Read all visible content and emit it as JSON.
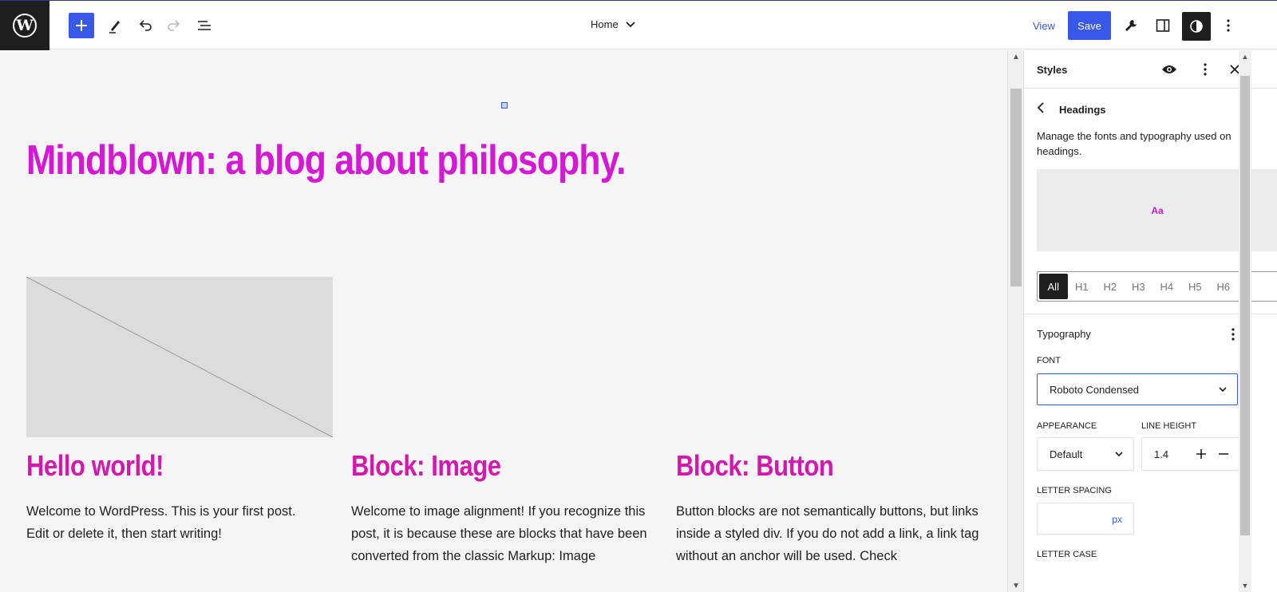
{
  "toolbar": {
    "page_title": "Home",
    "view_label": "View",
    "save_label": "Save",
    "accent_color": "#3858e9"
  },
  "canvas": {
    "site_title": "Mindblown: a blog about philosophy.",
    "heading_color": "#d418d4",
    "posts": [
      {
        "title": "Hello world!",
        "excerpt": "Welcome to WordPress. This is your first post. Edit or delete it, then start writing!"
      },
      {
        "title": "Block: Image",
        "excerpt": "Welcome to image alignment! If you recognize this post, it is because these are blocks that have been converted from the classic Markup: Image"
      },
      {
        "title": "Block: Button",
        "excerpt": "Button blocks are not semantically buttons, but links inside a styled div.  If you do not add a link, a link tag without an anchor will be used. Check"
      }
    ]
  },
  "sidebar": {
    "title": "Styles",
    "section_title": "Headings",
    "description": "Manage the fonts and typography used on headings.",
    "preview_text": "Aa",
    "levels": [
      "All",
      "H1",
      "H2",
      "H3",
      "H4",
      "H5",
      "H6"
    ],
    "active_level": "All",
    "typography_title": "Typography",
    "font_label": "FONT",
    "font_value": "Roboto Condensed",
    "appearance_label": "APPEARANCE",
    "appearance_value": "Default",
    "line_height_label": "LINE HEIGHT",
    "line_height_value": "1.4",
    "letter_spacing_label": "LETTER SPACING",
    "letter_spacing_unit": "px",
    "letter_case_label": "LETTER CASE"
  },
  "icons": [
    "wordpress-icon",
    "plus-icon",
    "pen-icon",
    "undo-icon",
    "redo-icon",
    "list-view-icon",
    "chevron-down-icon",
    "wrench-icon",
    "sidebar-icon",
    "contrast-icon",
    "kebab-menu-icon",
    "eye-icon",
    "close-icon",
    "chevron-left-icon",
    "plus-icon",
    "minus-icon"
  ]
}
